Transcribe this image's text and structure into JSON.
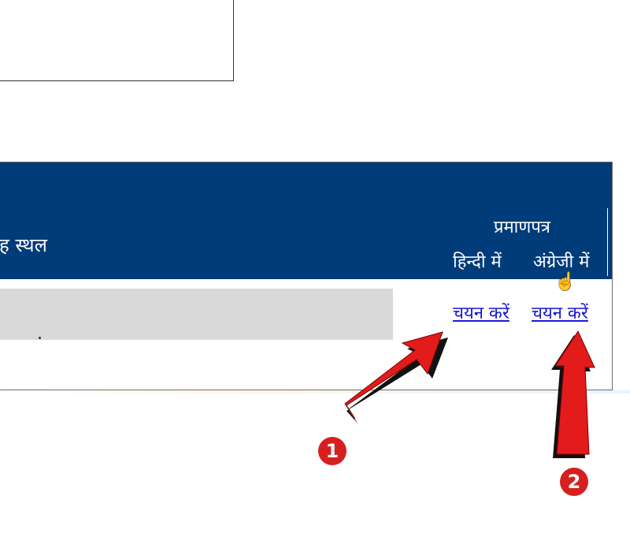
{
  "table": {
    "place_header": "ह स्थल",
    "certificate_header": "प्रमाणपत्र",
    "lang_hindi": "हिन्दी में",
    "lang_english": "अंग्रेजी में",
    "row": {
      "select_hindi": "चयन करें",
      "select_english": "चयन करें"
    }
  },
  "annotations": {
    "badge_1": "1",
    "badge_2": "2",
    "arrow_color": "#e31b1b",
    "header_color": "#003c7a",
    "link_color": "#1a1ad6"
  },
  "icons": {
    "cursor": "hand-pointer-icon"
  }
}
